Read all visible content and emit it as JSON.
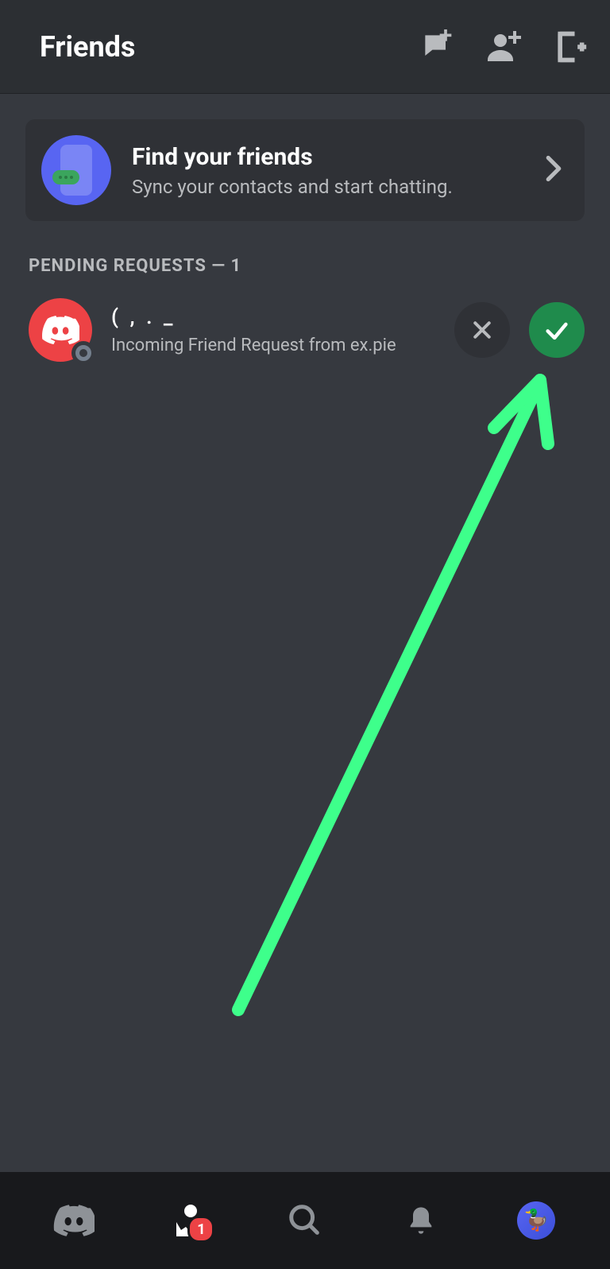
{
  "header": {
    "title": "Friends"
  },
  "findCard": {
    "title": "Find your friends",
    "subtitle": "Sync your contacts and start chatting."
  },
  "pending": {
    "header": "PENDING REQUESTS — 1",
    "item": {
      "name": "(  ,  . _",
      "subtitle": "Incoming Friend Request from ex.pie"
    }
  },
  "bottomNav": {
    "badge": "1"
  }
}
